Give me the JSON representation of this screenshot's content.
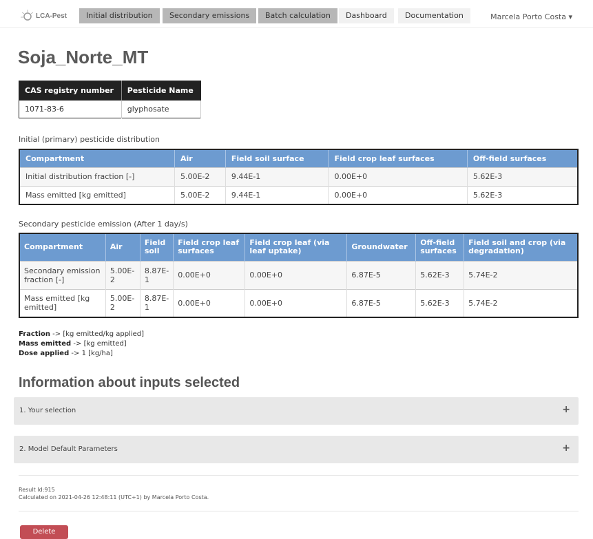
{
  "nav": {
    "logo_text": "LCA-Pest",
    "tabs": [
      {
        "label": "Initial distribution"
      },
      {
        "label": "Secondary emissions"
      },
      {
        "label": "Batch calculation"
      },
      {
        "label": "Dashboard"
      },
      {
        "label": "Documentation"
      }
    ],
    "user": "Marcela Porto Costa ▾"
  },
  "page_title": "Soja_Norte_MT",
  "cas_table": {
    "headers": [
      "CAS registry number",
      "Pesticide Name"
    ],
    "row": [
      "1071-83-6",
      "glyphosate"
    ]
  },
  "initial": {
    "caption": "Initial (primary) pesticide distribution",
    "headers": [
      "Compartment",
      "Air",
      "Field soil surface",
      "Field crop leaf surfaces",
      "Off-field surfaces"
    ],
    "rows": [
      [
        "Initial distribution fraction [-]",
        "5.00E-2",
        "9.44E-1",
        "0.00E+0",
        "5.62E-3"
      ],
      [
        "Mass emitted [kg emitted]",
        "5.00E-2",
        "9.44E-1",
        "0.00E+0",
        "5.62E-3"
      ]
    ]
  },
  "secondary": {
    "caption": "Secondary pesticide emission (After 1 day/s)",
    "headers": [
      "Compartment",
      "Air",
      "Field soil",
      "Field crop leaf surfaces",
      "Field crop leaf (via leaf uptake)",
      "Groundwater",
      "Off-field surfaces",
      "Field soil and crop (via degradation)"
    ],
    "rows": [
      [
        "Secondary emission fraction [-]",
        "5.00E-2",
        "8.87E-1",
        "0.00E+0",
        "0.00E+0",
        "6.87E-5",
        "5.62E-3",
        "5.74E-2"
      ],
      [
        "Mass emitted [kg emitted]",
        "5.00E-2",
        "8.87E-1",
        "0.00E+0",
        "0.00E+0",
        "6.87E-5",
        "5.62E-3",
        "5.74E-2"
      ]
    ]
  },
  "legend": {
    "fraction_key": "Fraction",
    "fraction_val": " -> [kg emitted/kg applied]",
    "mass_key": "Mass emitted",
    "mass_val": " -> [kg emitted]",
    "dose_key": "Dose applied",
    "dose_val": " -> 1 [kg/ha]"
  },
  "info": {
    "title": "Information about inputs selected",
    "panels": [
      {
        "label": "1. Your selection",
        "icon": "+"
      },
      {
        "label": "2. Model Default Parameters",
        "icon": "+"
      }
    ]
  },
  "result": {
    "id_line": "Result Id:915",
    "calc_line": "Calculated on 2021-04-26 12:48:11 (UTC+1) by Marcela Porto Costa."
  },
  "actions": {
    "delete_label": "Delete"
  },
  "colors": {
    "table_header": "#6d9bd0",
    "delete_button": "#c24d55",
    "nav_active": "#b7b7b7"
  }
}
